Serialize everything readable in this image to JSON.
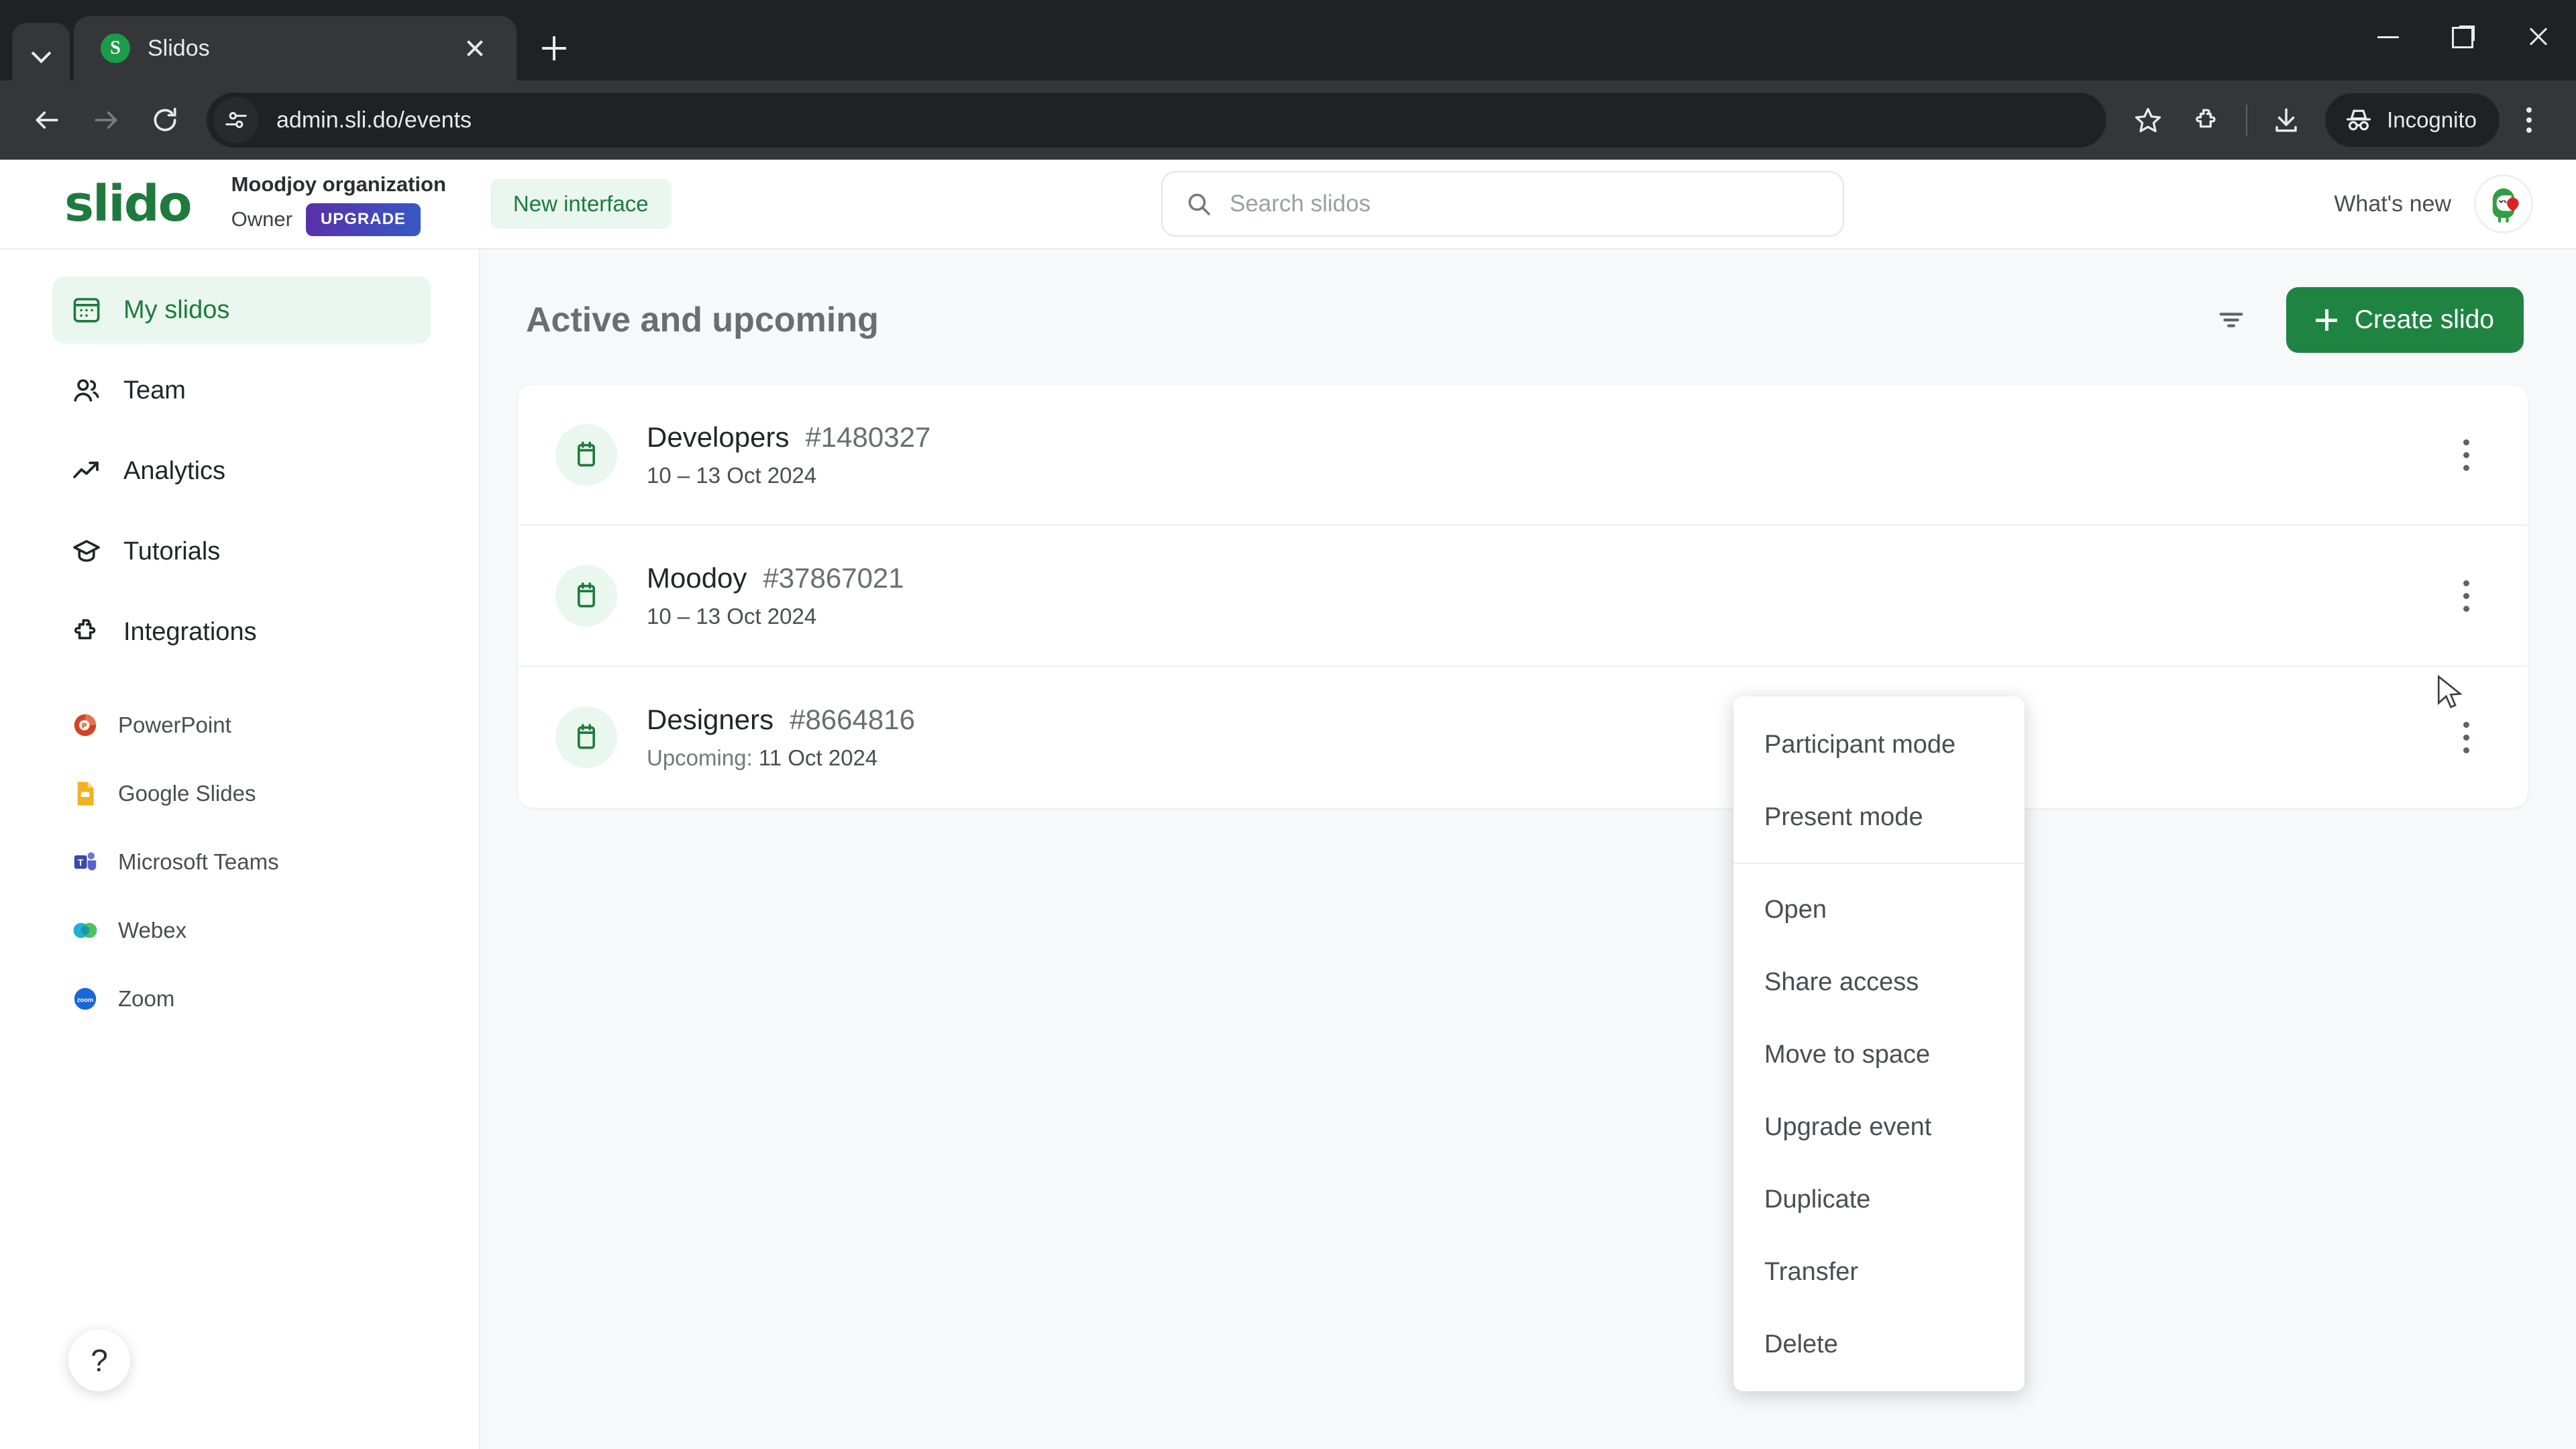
{
  "browser": {
    "tab_search_icon": "chevron-down-icon",
    "tab": {
      "title": "Slidos",
      "favicon_letter": "S",
      "favicon_color": "#1a9c4b"
    },
    "new_tab_label": "+",
    "url": "admin.sli.do/events",
    "site_info_icon": "tune-icon",
    "bookmark_icon": "star-icon",
    "extensions_icon": "puzzle-icon",
    "download_icon": "download-icon",
    "profile_label": "Incognito",
    "profile_icon": "incognito-hat-icon",
    "menu_icon": "kebab-menu-icon",
    "window_controls": {
      "minimize": "minimize-icon",
      "maximize": "restore-icon",
      "close": "close-icon"
    }
  },
  "header": {
    "logo_text": "slido",
    "logo_color": "#1f7a3d",
    "org_name": "Moodjoy organization",
    "org_role": "Owner",
    "upgrade_label": "UPGRADE",
    "new_interface_label": "New interface",
    "search": {
      "value": "",
      "placeholder": "Search slidos",
      "icon": "search-icon"
    },
    "whats_new_label": "What's new",
    "avatar_name": "user-avatar"
  },
  "sidebar": {
    "items": [
      {
        "label": "My slidos",
        "icon": "calendar-grid-icon",
        "active": true
      },
      {
        "label": "Team",
        "icon": "people-icon",
        "active": false
      },
      {
        "label": "Analytics",
        "icon": "trend-up-icon",
        "active": false
      },
      {
        "label": "Tutorials",
        "icon": "graduation-cap-icon",
        "active": false
      },
      {
        "label": "Integrations",
        "icon": "puzzle-piece-icon",
        "active": false
      }
    ],
    "integrations": [
      {
        "label": "PowerPoint",
        "icon": "powerpoint-icon"
      },
      {
        "label": "Google Slides",
        "icon": "google-slides-icon"
      },
      {
        "label": "Microsoft Teams",
        "icon": "microsoft-teams-icon"
      },
      {
        "label": "Webex",
        "icon": "webex-icon"
      },
      {
        "label": "Zoom",
        "icon": "zoom-icon"
      }
    ],
    "help_label": "?"
  },
  "main": {
    "title": "Active and upcoming",
    "filter_icon": "filter-icon",
    "create_label": "Create slido",
    "accent_color": "#1f8442",
    "events": [
      {
        "name": "Developers",
        "code": "#1480327",
        "date_prefix": "",
        "date": "10 – 13 Oct 2024",
        "icon": "calendar-icon"
      },
      {
        "name": "Moodoy",
        "code": "#37867021",
        "date_prefix": "",
        "date": "10 – 13 Oct 2024",
        "icon": "calendar-icon"
      },
      {
        "name": "Designers",
        "code": "#8664816",
        "date_prefix": "Upcoming: ",
        "date": "11 Oct 2024",
        "icon": "calendar-icon"
      }
    ]
  },
  "context_menu": {
    "groups": [
      [
        "Participant mode",
        "Present mode"
      ],
      [
        "Open",
        "Share access",
        "Move to space",
        "Upgrade event",
        "Duplicate",
        "Transfer",
        "Delete"
      ]
    ]
  }
}
